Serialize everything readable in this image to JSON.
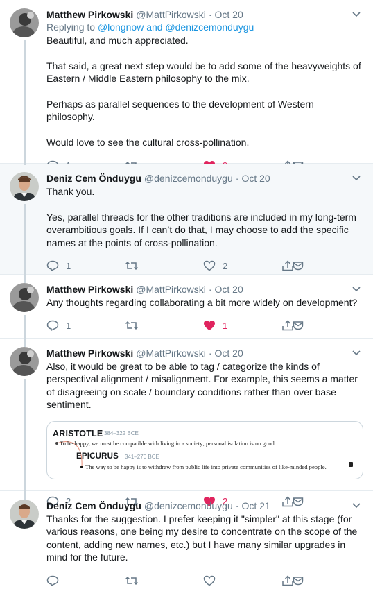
{
  "tweets": [
    {
      "name": "Matthew Pirkowski",
      "handle": "@MattPirkowski",
      "time": "Oct 20",
      "reply_prefix": "Replying to",
      "reply_users": "@longnow and @denizcemonduygu",
      "text": "Beautiful, and much appreciated.\n\nThat said, a great next step would be to add some of the heavyweights of Eastern / Middle Eastern philosophy to the mix.\n\nPerhaps as parallel sequences to the development of Western philosophy.\n\nWould love to see the cultural cross-pollination.",
      "replies": "1",
      "retweets": "",
      "likes": "9",
      "liked": true
    },
    {
      "name": "Deniz Cem Önduygu",
      "handle": "@denizcemonduygu",
      "time": "Oct 20",
      "text": "Thank you.\n\nYes, parallel threads for the other traditions are included in my long-term overambitious goals. If I can’t do that, I may choose to add the specific names at the points of cross-pollination.",
      "replies": "1",
      "retweets": "",
      "likes": "2",
      "liked": false
    },
    {
      "name": "Matthew Pirkowski",
      "handle": "@MattPirkowski",
      "time": "Oct 20",
      "text": "Any thoughts regarding collaborating a bit more widely on development?",
      "replies": "1",
      "retweets": "",
      "likes": "1",
      "liked": true
    },
    {
      "name": "Matthew Pirkowski",
      "handle": "@MattPirkowski",
      "time": "Oct 20",
      "text": "Also, it would be great to be able to tag / categorize the kinds of perspectival alignment / misalignment. For example, this seems a matter of disagreeing on scale / boundary conditions rather than over base sentiment.",
      "replies": "2",
      "retweets": "",
      "likes": "2",
      "liked": true,
      "card": {
        "a_name": "ARISTOTLE",
        "a_dates": "384–322 BCE",
        "a_quote": "To be happy, we must be compatible with living in a society; personal isolation is no good.",
        "e_name": "EPICURUS",
        "e_dates": "341–270 BCE",
        "e_quote": "The way to be happy is to withdraw from public life into private communities of like-minded people."
      }
    },
    {
      "name": "Deniz Cem Önduygu",
      "handle": "@denizcemonduygu",
      "time": "Oct 21",
      "text": "Thanks for the suggestion. I prefer keeping it \"simpler\" at this stage (for various reasons, one being my desire to concentrate on the scope of the content, adding new names, etc.) but I have many similar upgrades in mind for the future.",
      "replies": "",
      "retweets": "",
      "likes": "",
      "liked": false
    }
  ],
  "colors": {
    "like": "#e0245e",
    "icon": "#657786",
    "link": "#1b95e0",
    "thread_line": "#ccd6dd",
    "highlight_bg": "#f5f8fa"
  }
}
